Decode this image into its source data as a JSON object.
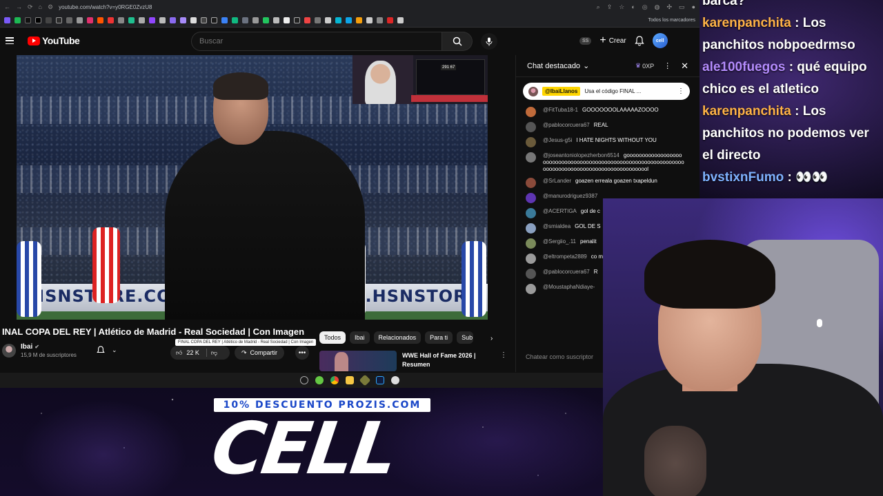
{
  "browser": {
    "url": "youtube.com/watch?v=y0RGE0ZvzU8",
    "all_bookmarks": "Todos los marcadores"
  },
  "youtube": {
    "logo": "YouTube",
    "search_placeholder": "Buscar",
    "ss_badge": "SS",
    "create_label": "Crear",
    "avatar_label": "cell"
  },
  "video": {
    "title": "INAL COPA DEL REY | Atlético de Madrid - Real Sociedad | Con Imagen",
    "tooltip": "FINAL COPA DEL REY | Atlético de Madrid - Real Sociedad | Con Imagen",
    "board_left": "HSNSTORE.COM",
    "board_right": "W.HSNSTOR",
    "channel_name": "Ibai",
    "channel_subs": "15,9 M de suscriptores",
    "likes": "22 K",
    "share_label": "Compartir",
    "cam_score": "291 67"
  },
  "chips": [
    "Todos",
    "Ibai",
    "Relacionados",
    "Para ti",
    "Sub"
  ],
  "recommendation": {
    "title": "WWE Hall of Fame 2026 | Resumen"
  },
  "chat": {
    "header": "Chat destacado",
    "points": "0XP",
    "pinned_name": "@IbaiLlanos",
    "pinned_text": "Usa el código FINAL ...",
    "input_placeholder": "Chatear como suscriptor",
    "messages": [
      {
        "name": "@FitTuba18-1",
        "text": "GOOOOOOOLAAAAAZOOOO",
        "color": "#c06a3a"
      },
      {
        "name": "@pablocorcuera67",
        "text": "REAL",
        "color": "#555555"
      },
      {
        "name": "@Jesus-g5i",
        "text": "I HATE NIGHTS WITHOUT YOU",
        "color": "#6a5a3a"
      },
      {
        "name": "@joseantoniolopezherbon6514",
        "text": "gooooooooooooooooooooooooooooooooooooooooooooooooooooooooooooooooooooooooooooooooooooooooooooooooool",
        "color": "#777777"
      },
      {
        "name": "@SrLander",
        "text": "goazen erreala goazen txapeldun",
        "color": "#8a4a3a"
      },
      {
        "name": "@manurodriguez9387",
        "text": "",
        "color": "#5e35b1"
      },
      {
        "name": "@ACERTIGA",
        "text": "gol de c",
        "color": "#3a7a9a"
      },
      {
        "name": "@smialdea",
        "text": "GOL DE S",
        "color": "#8aa0c0"
      },
      {
        "name": "@Sergiio_.11",
        "text": "penalit",
        "color": "#7a8a5a"
      },
      {
        "name": "@eltrompeta2889",
        "text": "co marrero a rematar y g 🤣",
        "color": "#9a9a9a"
      },
      {
        "name": "@pablocorcuera67",
        "text": "R",
        "color": "#555555"
      },
      {
        "name": "@MoustaphaNdiaye-",
        "text": "",
        "color": "#9a9a9a"
      }
    ]
  },
  "overlay_chat": [
    {
      "name": "",
      "text": "barca?",
      "style": "plain"
    },
    {
      "name": "karenpanchita",
      "text": ": Los panchitos nobpoedrmso",
      "style": "orange"
    },
    {
      "name": "ale100fuegos",
      "text": ": qué equipo chico es el atletico",
      "style": "purple"
    },
    {
      "name": "karenpanchita",
      "text": ": Los panchitos no podemos ver el directo",
      "style": "orange"
    },
    {
      "name": "bvstixnFumo",
      "text": ": 👀👀",
      "style": "blue"
    }
  ],
  "promo": {
    "banner": "10% DESCUENTO PROZIS.COM",
    "logo": "CELL"
  }
}
